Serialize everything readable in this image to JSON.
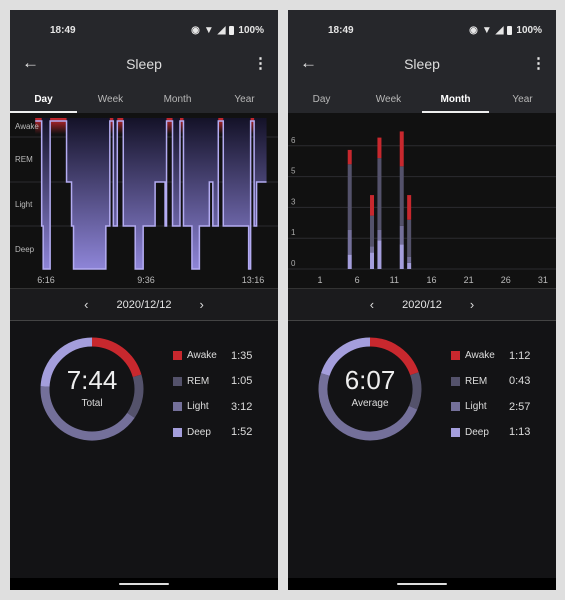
{
  "colors": {
    "awake": "#c8282e",
    "rem": "#54526b",
    "light": "#74709a",
    "deep": "#a49edc",
    "accent_line": "#b4acf2"
  },
  "panels": [
    {
      "status": {
        "time": "18:49",
        "battery": "100%",
        "icons": [
          "eye-icon",
          "wifi-icon",
          "signal-icon",
          "battery-icon"
        ]
      },
      "toolbar": {
        "title": "Sleep",
        "back_icon": "arrow-left-icon",
        "menu_icon": "more-vert-icon"
      },
      "tabs": [
        {
          "label": "Day",
          "active": true
        },
        {
          "label": "Week",
          "active": false
        },
        {
          "label": "Month",
          "active": false
        },
        {
          "label": "Year",
          "active": false
        }
      ],
      "date": "2020/12/12",
      "summary": {
        "value": "7:44",
        "label": "Total",
        "legend": [
          {
            "stage": "Awake",
            "value": "1:35",
            "minutes": 95
          },
          {
            "stage": "REM",
            "value": "1:05",
            "minutes": 65
          },
          {
            "stage": "Light",
            "value": "3:12",
            "minutes": 192
          },
          {
            "stage": "Deep",
            "value": "1:52",
            "minutes": 112
          }
        ]
      }
    },
    {
      "status": {
        "time": "18:49",
        "battery": "100%",
        "icons": [
          "eye-icon",
          "wifi-icon",
          "signal-icon",
          "battery-icon"
        ]
      },
      "toolbar": {
        "title": "Sleep",
        "back_icon": "arrow-left-icon",
        "menu_icon": "more-vert-icon"
      },
      "tabs": [
        {
          "label": "Day",
          "active": false
        },
        {
          "label": "Week",
          "active": false
        },
        {
          "label": "Month",
          "active": true
        },
        {
          "label": "Year",
          "active": false
        }
      ],
      "date": "2020/12",
      "summary": {
        "value": "6:07",
        "label": "Average",
        "legend": [
          {
            "stage": "Awake",
            "value": "1:12",
            "minutes": 72
          },
          {
            "stage": "REM",
            "value": "0:43",
            "minutes": 43
          },
          {
            "stage": "Light",
            "value": "2:57",
            "minutes": 177
          },
          {
            "stage": "Deep",
            "value": "1:13",
            "minutes": 73
          }
        ]
      }
    }
  ],
  "chart_data": [
    {
      "type": "line",
      "stages": [
        "Awake",
        "REM",
        "Light",
        "Deep"
      ],
      "x_ticks": [
        "6:16",
        "9:36",
        "13:16"
      ],
      "segments": [
        [
          "6:13",
          "Awake"
        ],
        [
          "6:26",
          "Light"
        ],
        [
          "6:29",
          "Deep"
        ],
        [
          "6:43",
          "Awake"
        ],
        [
          "7:16",
          "REM"
        ],
        [
          "7:26",
          "Light"
        ],
        [
          "7:30",
          "Deep"
        ],
        [
          "8:35",
          "Light"
        ],
        [
          "8:43",
          "Awake"
        ],
        [
          "8:50",
          "Light"
        ],
        [
          "8:58",
          "Awake"
        ],
        [
          "9:10",
          "Light"
        ],
        [
          "9:34",
          "Deep"
        ],
        [
          "9:50",
          "Light"
        ],
        [
          "10:14",
          "REM"
        ],
        [
          "10:34",
          "Light"
        ],
        [
          "10:37",
          "Awake"
        ],
        [
          "10:49",
          "Light"
        ],
        [
          "11:04",
          "Awake"
        ],
        [
          "11:11",
          "Light"
        ],
        [
          "11:28",
          "Deep"
        ],
        [
          "11:43",
          "Light"
        ],
        [
          "12:03",
          "REM"
        ],
        [
          "12:10",
          "Light"
        ],
        [
          "12:21",
          "Awake"
        ],
        [
          "12:31",
          "Light"
        ],
        [
          "13:22",
          "Deep"
        ],
        [
          "13:26",
          "Awake"
        ],
        [
          "13:33",
          "Light"
        ],
        [
          "13:38",
          "REM"
        ]
      ],
      "end": "13:58"
    },
    {
      "type": "bar",
      "stacked": true,
      "x_ticks": [
        "1",
        "6",
        "11",
        "16",
        "21",
        "26",
        "31"
      ],
      "y_ticks": [
        "0",
        "1",
        "3",
        "5",
        "6"
      ],
      "ylim": [
        0,
        6.6
      ],
      "stack_order": [
        "Deep",
        "Light",
        "REM",
        "Awake"
      ],
      "bars": [
        {
          "day": 5,
          "values": [
            0.7,
            1.2,
            3.2,
            0.7
          ]
        },
        {
          "day": 8,
          "values": [
            0.8,
            0.3,
            1.5,
            1.0
          ]
        },
        {
          "day": 9,
          "values": [
            1.4,
            0.5,
            3.5,
            1.0
          ]
        },
        {
          "day": 12,
          "values": [
            1.2,
            0.9,
            2.9,
            1.7
          ]
        },
        {
          "day": 13,
          "values": [
            0.3,
            0.3,
            1.8,
            1.2
          ]
        }
      ]
    }
  ]
}
